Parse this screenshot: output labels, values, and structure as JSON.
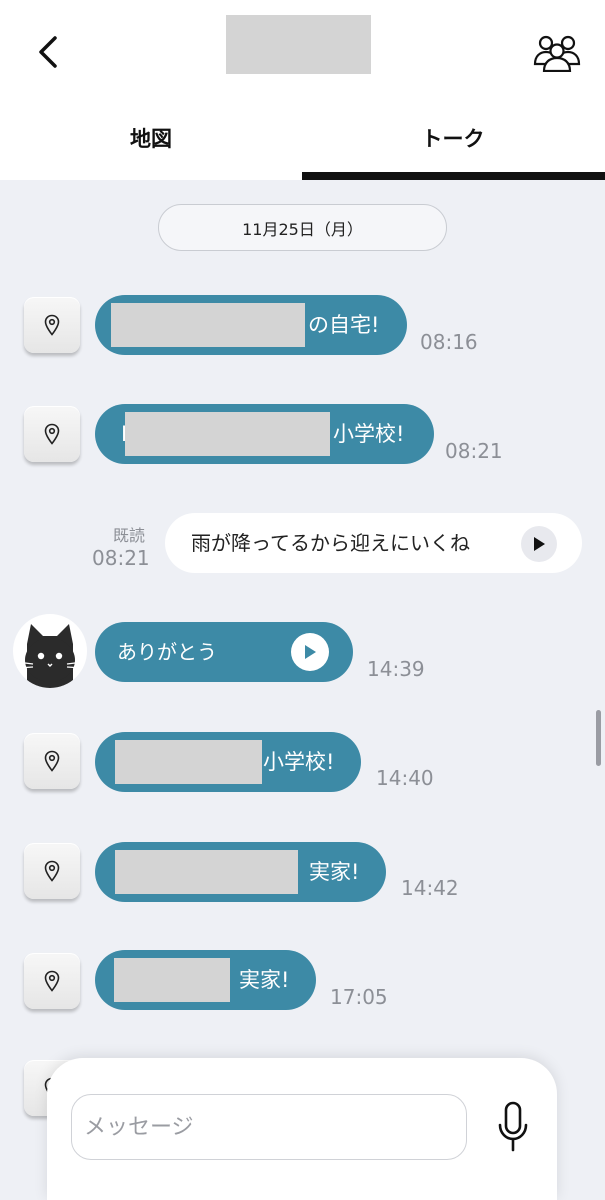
{
  "header": {
    "tabs": [
      {
        "label": "地図",
        "active": false
      },
      {
        "label": "トーク",
        "active": true
      }
    ]
  },
  "date_separator": "11月25日（月）",
  "messages": [
    {
      "type": "location",
      "text_suffix": "の自宅!",
      "time": "08:16"
    },
    {
      "type": "location",
      "text_prefix": "I",
      "text_suffix": "小学校!",
      "time": "08:21"
    },
    {
      "type": "outgoing_voice",
      "read_label": "既読",
      "time": "08:21",
      "text": "雨が降ってるから迎えにいくね"
    },
    {
      "type": "incoming_voice",
      "text": "ありがとう",
      "time": "14:39"
    },
    {
      "type": "location",
      "text_suffix": "小学校!",
      "time": "14:40"
    },
    {
      "type": "location",
      "text_suffix": "実家!",
      "time": "14:42"
    },
    {
      "type": "location",
      "text_suffix": "実家!",
      "time": "17:05"
    }
  ],
  "composer": {
    "placeholder": "メッセージ"
  },
  "icons": {
    "back": "chevron-left-icon",
    "group": "group-icon",
    "location": "map-pin-icon",
    "play": "play-icon",
    "mic": "microphone-icon",
    "avatar": "black-cat-avatar"
  },
  "colors": {
    "bubble_incoming": "#3d8aa6",
    "background": "#eef0f5",
    "time_text": "#8c8f96"
  }
}
